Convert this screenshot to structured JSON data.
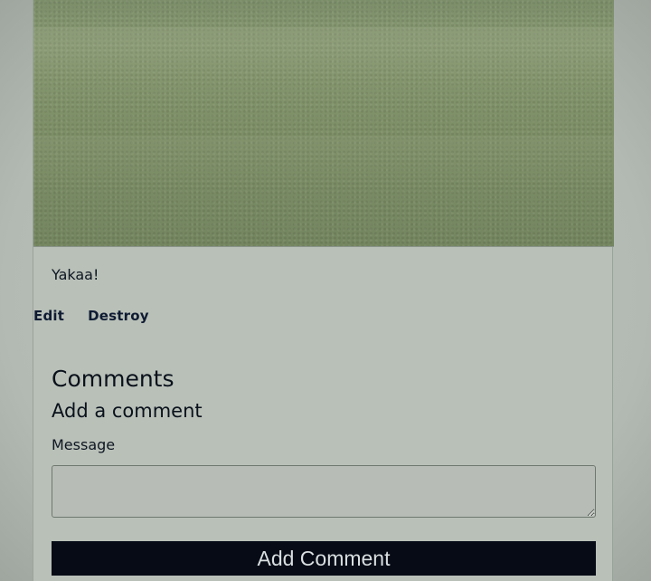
{
  "post": {
    "image": {
      "description": "grass field photo"
    },
    "caption": "Yakaa!"
  },
  "actions": {
    "edit_label": "Edit",
    "destroy_label": "Destroy"
  },
  "comments": {
    "heading": "Comments",
    "form": {
      "heading": "Add a comment",
      "message_label": "Message",
      "message_value": "",
      "submit_label": "Add Comment"
    }
  },
  "colors": {
    "button_bg": "#060b16",
    "page_bg": "#b9c0b8",
    "link_color": "#0f1b33"
  }
}
